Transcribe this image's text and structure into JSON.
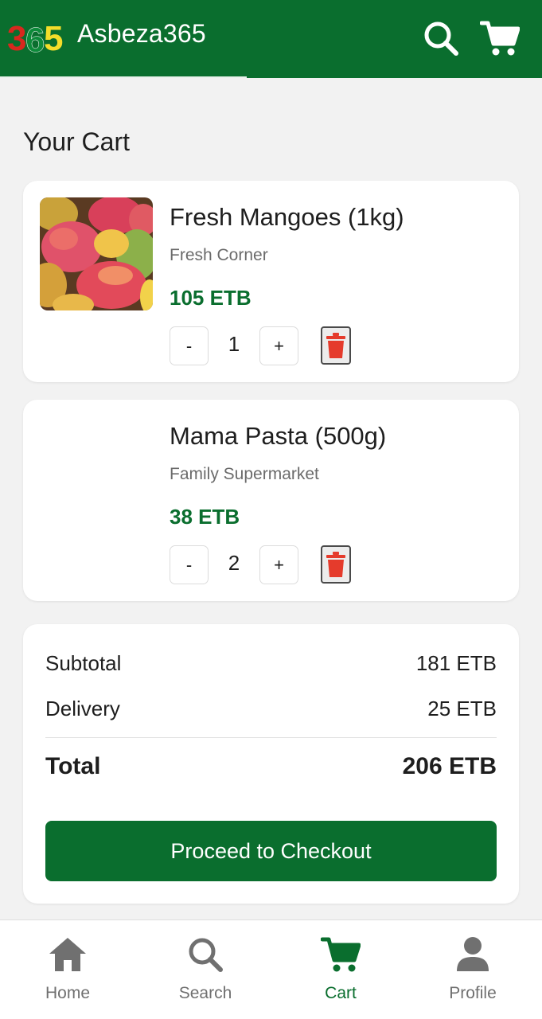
{
  "header": {
    "logo_text": "365",
    "brand": "Asbeza365",
    "search_icon": "search-icon",
    "cart_icon": "cart-icon"
  },
  "page_title": "Your Cart",
  "items": [
    {
      "name": "Fresh Mangoes (1kg)",
      "store": "Fresh Corner",
      "price": "105 ETB",
      "qty_minus": "-",
      "quantity": "1",
      "qty_plus": "+",
      "image": "mangoes-photo"
    },
    {
      "name": "Mama Pasta (500g)",
      "store": "Family Supermarket",
      "price": "38 ETB",
      "qty_minus": "-",
      "quantity": "2",
      "qty_plus": "+",
      "image": "blank-image"
    }
  ],
  "summary": {
    "subtotal_label": "Subtotal",
    "subtotal_value": "181 ETB",
    "delivery_label": "Delivery",
    "delivery_value": "25 ETB",
    "total_label": "Total",
    "total_value": "206 ETB",
    "checkout_label": "Proceed to Checkout"
  },
  "nav": [
    {
      "label": "Home",
      "icon": "home-icon"
    },
    {
      "label": "Search",
      "icon": "search-icon"
    },
    {
      "label": "Cart",
      "icon": "cart-icon",
      "active": true
    },
    {
      "label": "Profile",
      "icon": "profile-icon"
    }
  ],
  "colors": {
    "brand_green": "#0a6e2e",
    "delete_red": "#e53b2c",
    "muted_gray": "#707070"
  }
}
